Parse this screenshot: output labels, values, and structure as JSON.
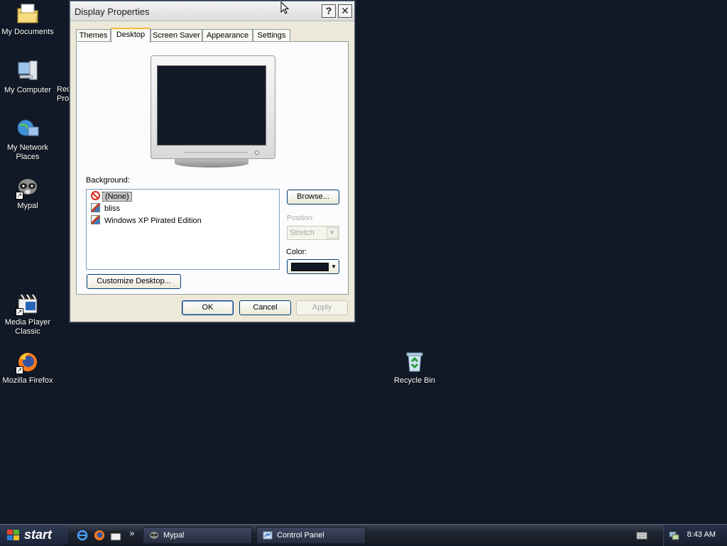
{
  "desktop": {
    "icons": {
      "my_documents": "My Documents",
      "my_computer": "My Computer",
      "my_network_places_1": "My Network",
      "my_network_places_2": "Places",
      "mypal": "Mypal",
      "media_player_1": "Media Player",
      "media_player_2": "Classic",
      "firefox": "Mozilla Firefox",
      "recycle_bin": "Recycle Bin"
    },
    "clipped_label_1": "Rec",
    "clipped_label_2": "Pro"
  },
  "dialog": {
    "title": "Display Properties",
    "help_glyph": "?",
    "close_glyph": "✕",
    "tabs": [
      "Themes",
      "Desktop",
      "Screen Saver",
      "Appearance",
      "Settings"
    ],
    "active_tab": "Desktop",
    "background_label": "Background:",
    "backgrounds": [
      {
        "name": "(None)",
        "icon": "none-icon",
        "selected": true
      },
      {
        "name": "bliss",
        "icon": "image-icon",
        "selected": false
      },
      {
        "name": "Windows XP Pirated Edition",
        "icon": "image-icon",
        "selected": false
      }
    ],
    "browse": "Browse...",
    "position_label": "Position:",
    "position_value": "Stretch",
    "color_label": "Color:",
    "color_value": "#111826",
    "customize": "Customize Desktop...",
    "ok": "OK",
    "cancel": "Cancel",
    "apply": "Apply"
  },
  "taskbar": {
    "start": "start",
    "tasks": [
      "Mypal",
      "Control Panel"
    ],
    "chevron": "»",
    "clock": "8:43 AM"
  }
}
